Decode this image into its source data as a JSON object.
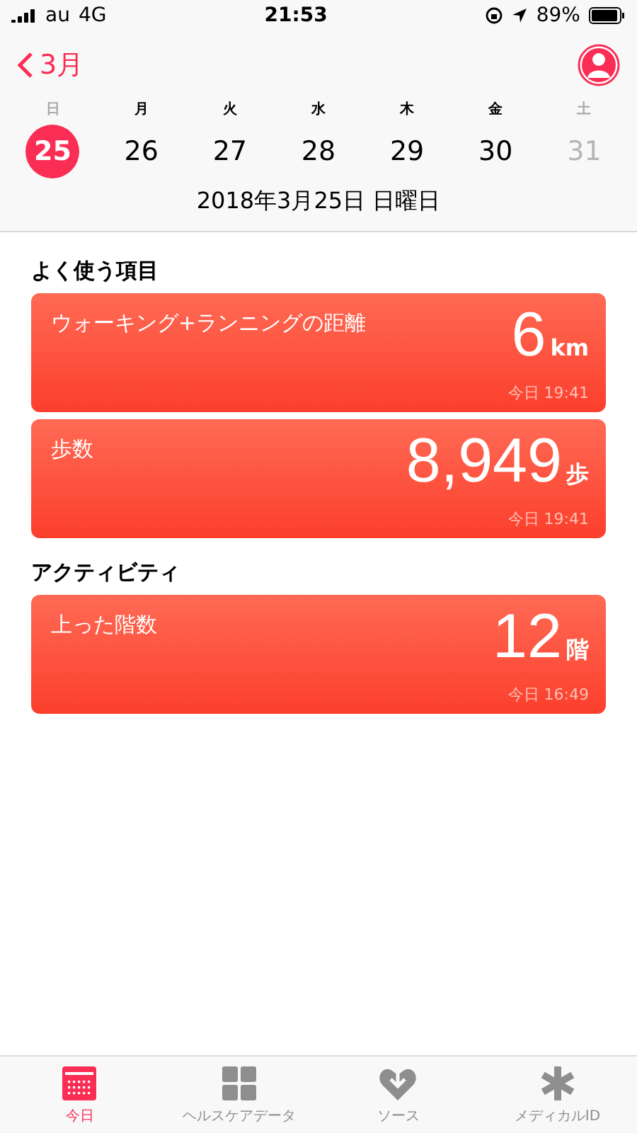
{
  "status_bar": {
    "carrier": "au",
    "network": "4G",
    "time": "21:53",
    "battery": "89%"
  },
  "nav": {
    "back": "3月"
  },
  "week": [
    {
      "weekday": "日",
      "day": "25",
      "selected": true,
      "disabled": false
    },
    {
      "weekday": "月",
      "day": "26",
      "selected": false,
      "disabled": false
    },
    {
      "weekday": "火",
      "day": "27",
      "selected": false,
      "disabled": false
    },
    {
      "weekday": "水",
      "day": "28",
      "selected": false,
      "disabled": false
    },
    {
      "weekday": "木",
      "day": "29",
      "selected": false,
      "disabled": false
    },
    {
      "weekday": "金",
      "day": "30",
      "selected": false,
      "disabled": false
    },
    {
      "weekday": "土",
      "day": "31",
      "selected": false,
      "disabled": true
    }
  ],
  "date_label": "2018年3月25日 日曜日",
  "sections": [
    {
      "title": "よく使う項目",
      "cards": [
        {
          "title": "ウォーキング+ランニングの距離",
          "value": "6",
          "unit": "km",
          "time": "今日 19:41"
        },
        {
          "title": "歩数",
          "value": "8,949",
          "unit": "歩",
          "time": "今日 19:41"
        }
      ]
    },
    {
      "title": "アクティビティ",
      "cards": [
        {
          "title": "上った階数",
          "value": "12",
          "unit": "階",
          "time": "今日 16:49"
        }
      ]
    }
  ],
  "tab_bar": [
    {
      "kind": "today",
      "label": "今日",
      "selected": true
    },
    {
      "kind": "data",
      "label": "ヘルスケアデータ",
      "selected": false
    },
    {
      "kind": "sources",
      "label": "ソース",
      "selected": false
    },
    {
      "kind": "medical",
      "label": "メディカルID",
      "selected": false
    }
  ]
}
